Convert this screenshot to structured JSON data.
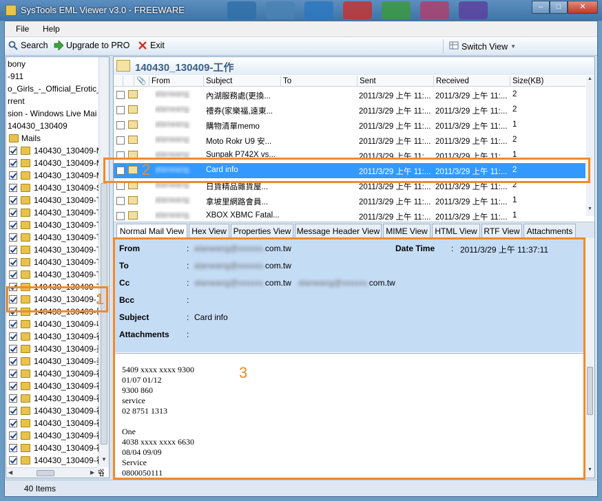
{
  "window": {
    "title": "SysTools EML Viewer v3.0 - FREEWARE"
  },
  "menu": {
    "file": "File",
    "help": "Help"
  },
  "toolbar": {
    "search": "Search",
    "upgrade": "Upgrade to PRO",
    "exit": "Exit",
    "switch_view": "Switch View"
  },
  "tree": {
    "partials": [
      "bony",
      "-911",
      "o_Girls_-_Official_Erotic_C",
      "rrent",
      "sion - Windows Live Mai",
      "140430_130409",
      "Mails"
    ],
    "items": [
      "140430_130409-M",
      "140430_130409-M",
      "140430_130409-M",
      "140430_130409-SC",
      "140430_130409-T",
      "140430_130409-T",
      "140430_130409-T",
      "140430_130409-T",
      "140430_130409-T",
      "140430_130409-T",
      "140430_130409-T",
      "140430_130409-T",
      "140430_130409-工",
      "140430_130409-巳",
      "140430_130409-收",
      "140430_130409-行",
      "140430_130409-美",
      "140430_130409-美",
      "140430_130409-裕",
      "140430_130409-裕",
      "140430_130409-裕",
      "140430_130409-裕",
      "140430_130409-裕",
      "140430_130409-裕",
      "140430_130409-裕",
      "140430_130409-裕",
      "140430_130409-裕"
    ]
  },
  "status": {
    "items": "40 Items"
  },
  "folder": {
    "title": "140430_130409-工作"
  },
  "grid": {
    "columns": {
      "from": "From",
      "subject": "Subject",
      "to": "To",
      "sent": "Sent",
      "received": "Received",
      "size": "Size(KB)"
    },
    "rows": [
      {
        "from": "alanwang",
        "subject": "內湖服務處(更換...",
        "sent": "2011/3/29 上午 11:...",
        "received": "2011/3/29 上午 11:...",
        "size": "2"
      },
      {
        "from": "alanwang",
        "subject": "禮券(家樂福,遠東...",
        "sent": "2011/3/29 上午 11:...",
        "received": "2011/3/29 上午 11:...",
        "size": "2"
      },
      {
        "from": "alanwang",
        "subject": "購物清單memo",
        "sent": "2011/3/29 上午 11:...",
        "received": "2011/3/29 上午 11:...",
        "size": "1"
      },
      {
        "from": "alanwang",
        "subject": "Moto Rokr U9 安...",
        "sent": "2011/3/29 上午 11:...",
        "received": "2011/3/29 上午 11:...",
        "size": "2"
      },
      {
        "from": "alanwang",
        "subject": "Sunpak P742X vs...",
        "sent": "2011/3/29 上午 11:...",
        "received": "2011/3/29 上午 11:...",
        "size": "1"
      },
      {
        "from": "alanwang",
        "subject": "Card info",
        "sent": "2011/3/29 上午 11:...",
        "received": "2011/3/29 上午 11:...",
        "size": "2"
      },
      {
        "from": "alanwang",
        "subject": "日貨精品雜貨屋...",
        "sent": "2011/3/29 上午 11:...",
        "received": "2011/3/29 上午 11:...",
        "size": "2"
      },
      {
        "from": "alanwang",
        "subject": "拿坡里網路會員...",
        "sent": "2011/3/29 上午 11:...",
        "received": "2011/3/29 上午 11:...",
        "size": "1"
      },
      {
        "from": "alanwang",
        "subject": "XBOX XBMC Fatal...",
        "sent": "2011/3/29 上午 11:...",
        "received": "2011/3/29 上午 11:...",
        "size": "1"
      }
    ]
  },
  "tabs": [
    "Normal Mail View",
    "Hex View",
    "Properties View",
    "Message Header View",
    "MIME View",
    "HTML View",
    "RTF View",
    "Attachments"
  ],
  "headers": {
    "from_label": "From",
    "from_value": "alanwang@xxxxxx.com.tw",
    "datetime_label": "Date Time",
    "datetime_value": "2011/3/29 上午 11:37:11",
    "to_label": "To",
    "to_value": "alanwang@xxxxxx.com.tw",
    "cc_label": "Cc",
    "cc_value": "alanwang@xxxxxx.com.tw  alanwang@xxxxxx.com.tw",
    "bcc_label": "Bcc",
    "subject_label": "Subject",
    "subject_value": "Card info",
    "attachments_label": "Attachments",
    "colon": ":"
  },
  "body": [
    "5409 xxxx xxxx 9300",
    "01/07 01/12",
    "9300 860",
    "service",
    "02 8751 1313",
    "",
    "One",
    "4038 xxxx xxxx 6630",
    "08/04 09/09",
    "Service",
    "0800050111"
  ],
  "annotations": {
    "one": "1",
    "two": "2",
    "three": "3"
  },
  "colors": {
    "accent": "#3399ff",
    "annotation": "#f08a2c",
    "header_bg": "#c5dcf5"
  }
}
